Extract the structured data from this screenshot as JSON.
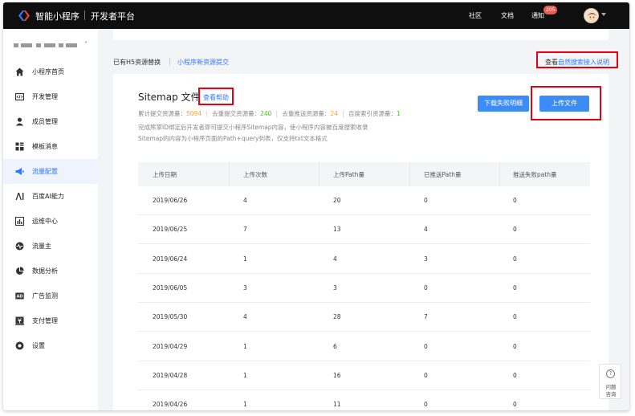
{
  "header": {
    "brand": "智能小程序",
    "subtitle": "开发者平台",
    "nav": [
      {
        "label": "社区"
      },
      {
        "label": "文档"
      },
      {
        "label": "通知"
      }
    ],
    "notification_count": "205"
  },
  "sidebar": {
    "account_caret": "˅",
    "items": [
      {
        "label": "小程序首页",
        "icon": "home-icon"
      },
      {
        "label": "开发管理",
        "icon": "code-icon"
      },
      {
        "label": "成员管理",
        "icon": "person-icon"
      },
      {
        "label": "模板消息",
        "icon": "template-icon"
      },
      {
        "label": "流量配置",
        "icon": "megaphone-icon",
        "active": true
      },
      {
        "label": "百度AI能力",
        "icon": "ai-icon"
      },
      {
        "label": "运维中心",
        "icon": "chart-icon"
      },
      {
        "label": "流量主",
        "icon": "pulse-icon"
      },
      {
        "label": "数据分析",
        "icon": "pie-icon"
      },
      {
        "label": "广告监测",
        "icon": "ad-icon"
      },
      {
        "label": "支付管理",
        "icon": "payment-icon"
      },
      {
        "label": "设置",
        "icon": "gear-icon"
      }
    ]
  },
  "tabs": {
    "tab1": "已有H5资源替换",
    "tab2": "小程序新资源提交"
  },
  "guide": {
    "prefix": "查看",
    "link": "自然搜索接入说明"
  },
  "sitemap": {
    "title": "Sitemap 文件",
    "help": "查看帮助",
    "stats": [
      {
        "label": "累计提交资源量：",
        "value": "5094"
      },
      {
        "label": "去重提交资源量：",
        "value": "240"
      },
      {
        "label": "去重推送资源量：",
        "value": "24"
      },
      {
        "label": "百度索引资源量：",
        "value": "1"
      }
    ],
    "desc1": "完成熊掌ID绑定后开发者即可提交小程序Sitemap内容，使小程序内容被百度搜索收录",
    "desc2": "Sitemap的内容为小程序页面的Path+query列表，仅支持txt文本格式",
    "download_button": "下载失败明细",
    "upload_button": "上传文件"
  },
  "table": {
    "columns": [
      "上传日期",
      "上传次数",
      "上传Path量",
      "已推送Path量",
      "推送失败path量"
    ],
    "rows": [
      [
        "2019/06/26",
        "4",
        "20",
        "0",
        "0"
      ],
      [
        "2019/06/25",
        "7",
        "13",
        "4",
        "0"
      ],
      [
        "2019/06/24",
        "1",
        "4",
        "3",
        "0"
      ],
      [
        "2019/06/05",
        "3",
        "3",
        "0",
        "0"
      ],
      [
        "2019/05/30",
        "4",
        "28",
        "7",
        "0"
      ],
      [
        "2019/04/29",
        "1",
        "6",
        "0",
        "0"
      ],
      [
        "2019/04/28",
        "1",
        "16",
        "0",
        "0"
      ],
      [
        "2019/04/26",
        "1",
        "11",
        "0",
        "0"
      ]
    ]
  },
  "help_float": {
    "line1": "问题",
    "line2": "咨询"
  },
  "colors": {
    "accent": "#3377ff",
    "button": "#3c8cf5",
    "highlight_box": "#e60012",
    "topbar": "#0f0f0f"
  }
}
